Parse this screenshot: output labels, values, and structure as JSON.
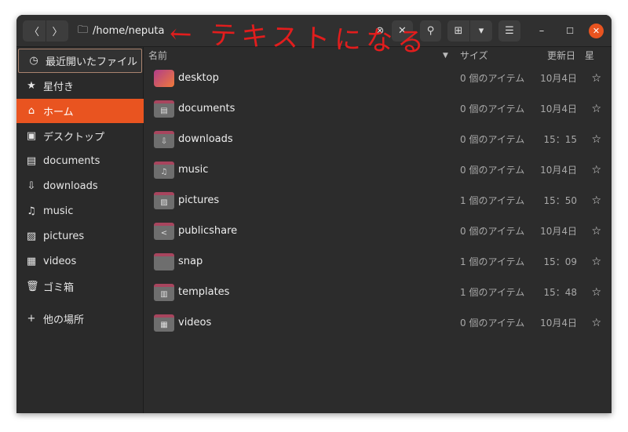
{
  "header": {
    "path": "/home/neputa",
    "view_menu_icon": "grid-icon",
    "annotation": "← テキストになる",
    "annotation_color": "#e21d1d"
  },
  "sidebar": {
    "items": [
      {
        "label": "最近開いたファイル",
        "icon": "clock-icon",
        "glyph": "◷"
      },
      {
        "label": "星付き",
        "icon": "star-icon",
        "glyph": "★"
      },
      {
        "label": "ホーム",
        "icon": "home-icon",
        "glyph": "⌂"
      },
      {
        "label": "デスクトップ",
        "icon": "desktop-icon",
        "glyph": "▣"
      },
      {
        "label": "documents",
        "icon": "document-icon",
        "glyph": "▤"
      },
      {
        "label": "downloads",
        "icon": "download-icon",
        "glyph": "⇩"
      },
      {
        "label": "music",
        "icon": "music-icon",
        "glyph": "♫"
      },
      {
        "label": "pictures",
        "icon": "picture-icon",
        "glyph": "▨"
      },
      {
        "label": "videos",
        "icon": "video-icon",
        "glyph": "▦"
      },
      {
        "label": "ゴミ箱",
        "icon": "trash-icon",
        "glyph": "🗑"
      },
      {
        "label": "他の場所",
        "icon": "plus-icon",
        "glyph": "+"
      }
    ],
    "active": "ホーム",
    "accent": "#e95420"
  },
  "columns": {
    "name": "名前",
    "size": "サイズ",
    "modified": "更新日",
    "star": "星"
  },
  "files": [
    {
      "name": "desktop",
      "size": "0 個のアイテム",
      "date": "10月4日",
      "emblem": ""
    },
    {
      "name": "documents",
      "size": "0 個のアイテム",
      "date": "10月4日",
      "emblem": "▤"
    },
    {
      "name": "downloads",
      "size": "0 個のアイテム",
      "date": "15：15",
      "emblem": "⇩"
    },
    {
      "name": "music",
      "size": "0 個のアイテム",
      "date": "10月4日",
      "emblem": "♫"
    },
    {
      "name": "pictures",
      "size": "1 個のアイテム",
      "date": "15：50",
      "emblem": "▨"
    },
    {
      "name": "publicshare",
      "size": "0 個のアイテム",
      "date": "10月4日",
      "emblem": "<"
    },
    {
      "name": "snap",
      "size": "1 個のアイテム",
      "date": "15：09",
      "emblem": ""
    },
    {
      "name": "templates",
      "size": "1 個のアイテム",
      "date": "15：48",
      "emblem": "▥"
    },
    {
      "name": "videos",
      "size": "0 個のアイテム",
      "date": "10月4日",
      "emblem": "▦"
    }
  ]
}
